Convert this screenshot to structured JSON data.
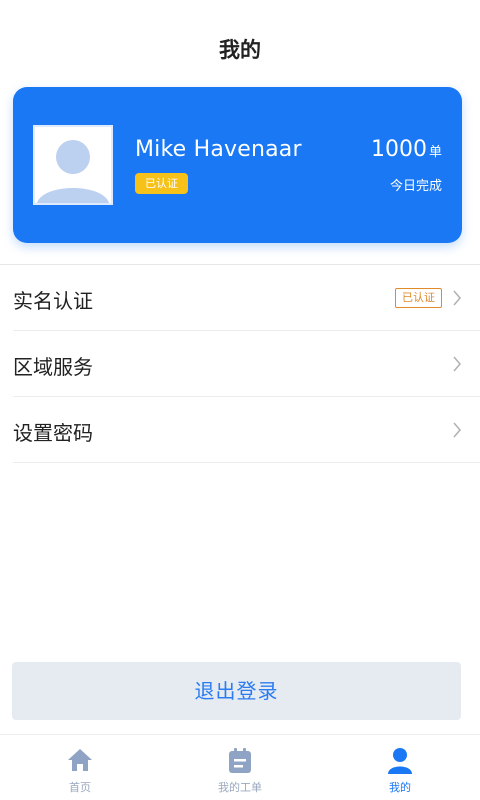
{
  "header": {
    "title": "我的"
  },
  "profile": {
    "name": "Mike Havenaar",
    "badge": "已认证",
    "today_count": "1000",
    "today_unit": "单",
    "today_label": "今日完成"
  },
  "menu": {
    "items": [
      {
        "label": "实名认证",
        "tag": "已认证"
      },
      {
        "label": "区域服务"
      },
      {
        "label": "设置密码"
      }
    ]
  },
  "logout_label": "退出登录",
  "tabbar": {
    "tabs": [
      {
        "label": "首页",
        "icon": "home-icon"
      },
      {
        "label": "我的工单",
        "icon": "work-order-icon"
      },
      {
        "label": "我的",
        "icon": "user-icon"
      }
    ],
    "active_index": 2
  },
  "colors": {
    "primary": "#1a78f5",
    "badge": "#f6c21a",
    "tag": "#e08a2c",
    "tab_inactive": "#9aa8bf"
  }
}
